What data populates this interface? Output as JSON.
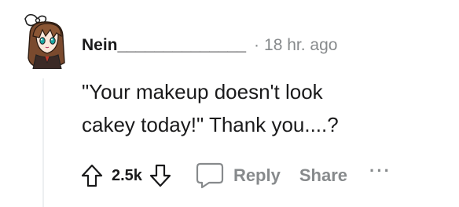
{
  "comment": {
    "author": "Nein______________",
    "separator": "·",
    "timestamp": "18 hr. ago",
    "text": "\"Your makeup doesn't look\ncakey today!\" Thank you....?",
    "score": "2.5k"
  },
  "actions": {
    "reply_label": "Reply",
    "share_label": "Share",
    "more_label": "···"
  },
  "icons": {
    "avatar": "avatar-anime-girl-icon",
    "upvote": "upvote-arrow-icon",
    "downvote": "downvote-arrow-icon",
    "reply": "speech-bubble-icon"
  },
  "colors": {
    "text": "#1a1a1b",
    "muted": "#878a8c",
    "thread_line": "#edeff1"
  }
}
